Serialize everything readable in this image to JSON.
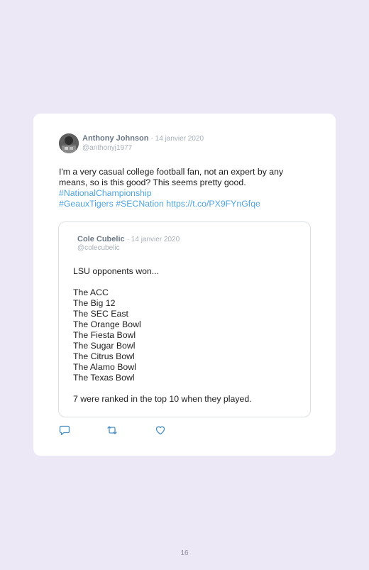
{
  "tweet": {
    "author_name": "Anthony Johnson",
    "date": "· 14 janvier 2020",
    "handle": "@anthonyj1977",
    "text_lines": [
      {
        "text": "I'm a very casual college football fan, not an expert by any",
        "link": false
      },
      {
        "text": "means, so is this good? This seems pretty good.",
        "link": false
      },
      {
        "text": "#NationalChampionship",
        "link": true
      },
      {
        "text": "#GeauxTigers #SECNation https://t.co/PX9FYnGfqe",
        "link": true
      }
    ]
  },
  "quoted": {
    "author_name": "Cole Cubelic",
    "date": "· 14 janvier 2020",
    "handle": "@colecubelic",
    "lines": [
      "LSU opponents won...",
      "",
      "The ACC",
      "The Big 12",
      "The SEC East",
      "The Orange Bowl",
      "The Fiesta Bowl",
      "The Sugar Bowl",
      "The Citrus Bowl",
      "The Alamo Bowl",
      "The Texas Bowl",
      "",
      "7 were ranked in the top 10 when they played."
    ]
  },
  "actions": [
    {
      "name": "reply-icon"
    },
    {
      "name": "retweet-icon"
    },
    {
      "name": "like-icon"
    }
  ],
  "page_number": "16",
  "colors": {
    "background": "#ece8f5",
    "link": "#4da3e0",
    "name": "#6b7785",
    "muted": "#a8b0b9"
  }
}
